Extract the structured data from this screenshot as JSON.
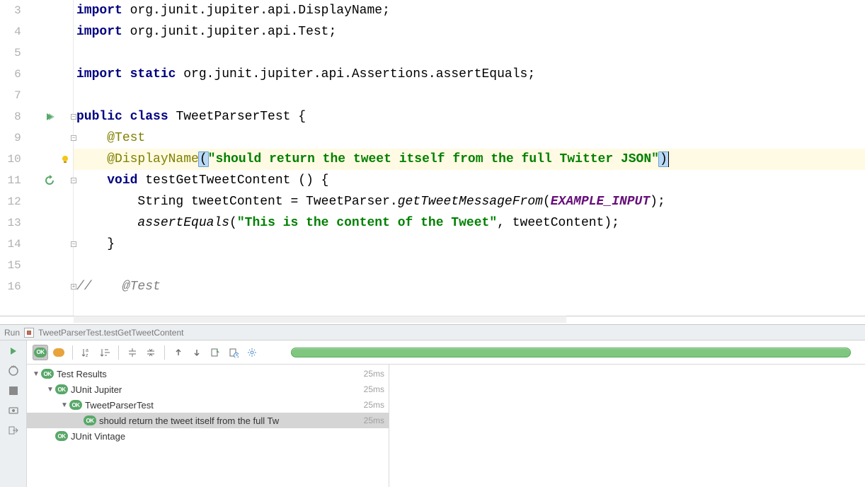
{
  "editor": {
    "lines": [
      {
        "n": 3,
        "indent": "",
        "tokens": [
          {
            "t": "import ",
            "c": "kw"
          },
          {
            "t": "org.junit.jupiter.api.DisplayName;",
            "c": "pkg"
          }
        ]
      },
      {
        "n": 4,
        "indent": "",
        "tokens": [
          {
            "t": "import ",
            "c": "kw"
          },
          {
            "t": "org.junit.jupiter.api.Test;",
            "c": "pkg"
          }
        ]
      },
      {
        "n": 5,
        "indent": "",
        "tokens": []
      },
      {
        "n": 6,
        "indent": "",
        "tokens": [
          {
            "t": "import static ",
            "c": "kw"
          },
          {
            "t": "org.junit.jupiter.api.Assertions.assertEquals;",
            "c": "pkg"
          }
        ]
      },
      {
        "n": 7,
        "indent": "",
        "tokens": []
      },
      {
        "n": 8,
        "indent": "",
        "tokens": [
          {
            "t": "public class ",
            "c": "kw"
          },
          {
            "t": "TweetParserTest {",
            "c": "pkg"
          }
        ],
        "run": true,
        "fold": "-"
      },
      {
        "n": 9,
        "indent": "    ",
        "tokens": [
          {
            "t": "@Test",
            "c": "ann"
          }
        ],
        "fold": "-"
      },
      {
        "n": 10,
        "indent": "    ",
        "tokens": [
          {
            "t": "@DisplayName",
            "c": "ann"
          },
          {
            "t": "(",
            "c": "bracket"
          },
          {
            "t": "\"should return the tweet itself from the full Twitter JSON\"",
            "c": "str"
          },
          {
            "t": ")",
            "c": "bracket"
          }
        ],
        "hl": true,
        "bulb": true,
        "cursor": true
      },
      {
        "n": 11,
        "indent": "    ",
        "tokens": [
          {
            "t": "void ",
            "c": "kw"
          },
          {
            "t": "testGetTweetContent () {",
            "c": "pkg"
          }
        ],
        "rerun": true,
        "fold": "-"
      },
      {
        "n": 12,
        "indent": "        ",
        "tokens": [
          {
            "t": "String tweetContent = TweetParser.",
            "c": "pkg"
          },
          {
            "t": "getTweetMessageFrom",
            "c": "italic"
          },
          {
            "t": "(",
            "c": "pkg"
          },
          {
            "t": "EXAMPLE_INPUT",
            "c": "stat"
          },
          {
            "t": ");",
            "c": "pkg"
          }
        ]
      },
      {
        "n": 13,
        "indent": "        ",
        "tokens": [
          {
            "t": "assertEquals",
            "c": "italic"
          },
          {
            "t": "(",
            "c": "pkg"
          },
          {
            "t": "\"This is the content of the Tweet\"",
            "c": "str"
          },
          {
            "t": ", tweetContent);",
            "c": "pkg"
          }
        ]
      },
      {
        "n": 14,
        "indent": "    ",
        "tokens": [
          {
            "t": "}",
            "c": "pkg"
          }
        ],
        "fold": "-"
      },
      {
        "n": 15,
        "indent": "",
        "tokens": []
      },
      {
        "n": 16,
        "indent": "",
        "tokens": [
          {
            "t": "//    @Test",
            "c": "cm"
          }
        ],
        "fold": "+"
      }
    ]
  },
  "runbar": {
    "label": "Run",
    "config": "TweetParserTest.testGetTweetContent"
  },
  "tree": {
    "rows": [
      {
        "indent": 0,
        "twist": true,
        "ok": true,
        "label": "Test Results",
        "time": "25ms"
      },
      {
        "indent": 1,
        "twist": true,
        "ok": true,
        "label": "JUnit Jupiter",
        "time": "25ms"
      },
      {
        "indent": 2,
        "twist": true,
        "ok": true,
        "label": "TweetParserTest",
        "time": "25ms"
      },
      {
        "indent": 3,
        "twist": false,
        "ok": true,
        "label": "should return the tweet itself from the full Tw",
        "time": "25ms",
        "sel": true
      },
      {
        "indent": 1,
        "twist": false,
        "ok": true,
        "label": "JUnit Vintage",
        "time": ""
      }
    ]
  }
}
